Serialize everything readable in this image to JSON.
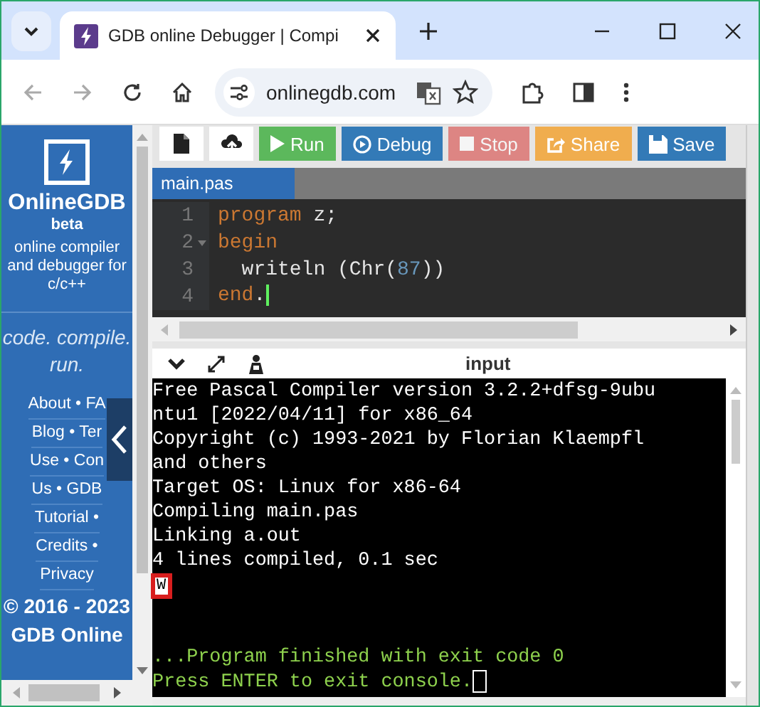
{
  "browser": {
    "tab_title": "GDB online Debugger | Compi",
    "address": "onlinegdb.com"
  },
  "sidebar": {
    "brand": "OnlineGDB",
    "badge": "beta",
    "tagline": "online compiler and debugger for c/c++",
    "motto": "code. compile. run.",
    "links": [
      "About • FA",
      "Blog • Ter",
      "Use • Con",
      "Us • GDB",
      "Tutorial •",
      "Credits •",
      "Privacy"
    ],
    "copyright": "© 2016 - 2023 GDB Online"
  },
  "toolbar": [
    {
      "kind": "new",
      "disabled": false
    },
    {
      "kind": "upload",
      "disabled": false
    },
    {
      "kind": "run",
      "label": "Run",
      "disabled": false
    },
    {
      "kind": "debug",
      "label": "Debug",
      "disabled": false
    },
    {
      "kind": "stop",
      "label": "Stop",
      "disabled": true
    },
    {
      "kind": "share",
      "label": "Share",
      "disabled": false
    },
    {
      "kind": "save",
      "label": "Save",
      "disabled": false
    }
  ],
  "file_tab": {
    "label": "main.pas",
    "selected": true
  },
  "editor": {
    "lines": [
      {
        "number": "1",
        "foldable": false,
        "tokens": [
          {
            "kind": "keyword",
            "text": "program"
          },
          {
            "kind": "plain",
            "text": " z;"
          }
        ]
      },
      {
        "number": "2",
        "foldable": true,
        "tokens": [
          {
            "kind": "keyword",
            "text": "begin"
          }
        ]
      },
      {
        "number": "3",
        "foldable": false,
        "tokens": [
          {
            "kind": "plain",
            "text": "  writeln (Chr("
          },
          {
            "kind": "number",
            "text": "87"
          },
          {
            "kind": "plain",
            "text": "))"
          }
        ]
      },
      {
        "number": "4",
        "foldable": false,
        "tokens": [
          {
            "kind": "keyword",
            "text": "end"
          },
          {
            "kind": "plain",
            "text": "."
          }
        ]
      }
    ]
  },
  "console": {
    "header": "input",
    "lines": [
      {
        "kind": "output",
        "text": "Free Pascal Compiler version 3.2.2+dfsg-9ubu"
      },
      {
        "kind": "output",
        "text": "ntu1 [2022/04/11] for x86_64"
      },
      {
        "kind": "output",
        "text": "Copyright (c) 1993-2021 by Florian Klaempfl"
      },
      {
        "kind": "output",
        "text": "and others"
      },
      {
        "kind": "output",
        "text": "Target OS: Linux for x86-64"
      },
      {
        "kind": "output",
        "text": "Compiling main.pas"
      },
      {
        "kind": "output",
        "text": "Linking a.out"
      },
      {
        "kind": "output",
        "text": "4 lines compiled, 0.1 sec"
      },
      {
        "kind": "marked",
        "text": "W"
      },
      {
        "kind": "blank"
      },
      {
        "kind": "blank"
      },
      {
        "kind": "status",
        "text": "...Program finished with exit code 0"
      },
      {
        "kind": "status",
        "text": "Press ENTER to exit console."
      }
    ]
  }
}
